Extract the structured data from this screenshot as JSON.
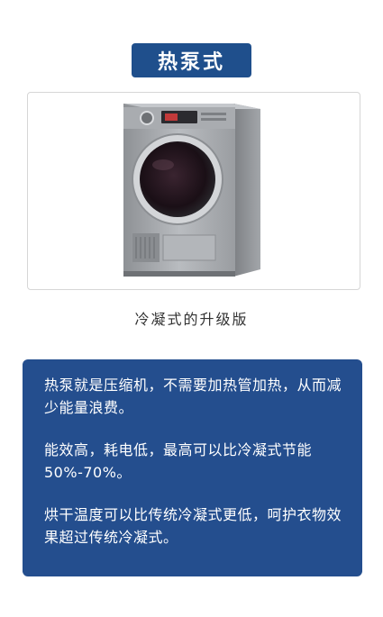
{
  "title": "热泵式",
  "product_image": {
    "subject": "heat-pump-dryer"
  },
  "caption": "冷凝式的升级版",
  "info": {
    "paragraphs": [
      "热泵就是压缩机，不需要加热管加热，从而减少能量浪费。",
      "能效高，耗电低，最高可以比冷凝式节能50%-70%。",
      "烘干温度可以比传统冷凝式更低，呵护衣物效果超过传统冷凝式。"
    ]
  },
  "colors": {
    "badge_bg": "#1f4f8c",
    "panel_bg": "#244e8e",
    "text_on_dark": "#ffffff"
  }
}
